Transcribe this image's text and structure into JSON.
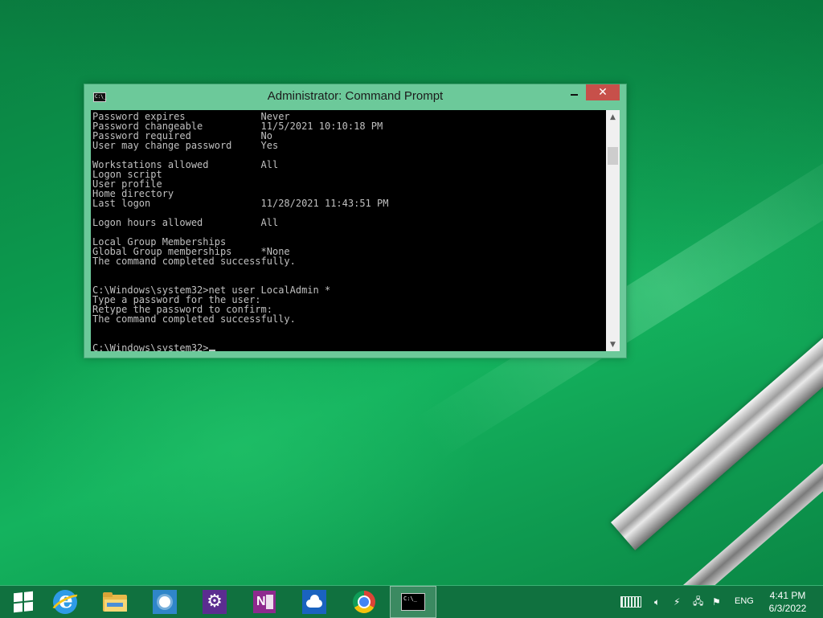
{
  "window": {
    "title": "Administrator: Command Prompt",
    "icon_label": "C:\\_"
  },
  "console": {
    "text": "Password expires             Never\nPassword changeable          11/5/2021 10:10:18 PM\nPassword required            No\nUser may change password     Yes\n\nWorkstations allowed         All\nLogon script\nUser profile\nHome directory\nLast logon                   11/28/2021 11:43:51 PM\n\nLogon hours allowed          All\n\nLocal Group Memberships\nGlobal Group memberships     *None\nThe command completed successfully.\n\n\nC:\\Windows\\system32>net user LocalAdmin *\nType a password for the user:\nRetype the password to confirm:\nThe command completed successfully.\n\n\n",
    "prompt": "C:\\Windows\\system32>"
  },
  "taskbar": {
    "apps": [
      {
        "name": "start",
        "icon": "windows-logo-icon"
      },
      {
        "name": "internet-explorer",
        "icon": "internet-explorer-icon"
      },
      {
        "name": "file-explorer",
        "icon": "folder-icon"
      },
      {
        "name": "weather",
        "icon": "sun-icon"
      },
      {
        "name": "settings",
        "icon": "gear-icon"
      },
      {
        "name": "onenote",
        "icon": "onenote-icon",
        "label": "N"
      },
      {
        "name": "onedrive",
        "icon": "cloud-icon"
      },
      {
        "name": "chrome",
        "icon": "chrome-icon"
      },
      {
        "name": "command-prompt",
        "icon": "command-prompt-icon",
        "label": "C:\\_",
        "active": true
      }
    ],
    "tray": {
      "language": "ENG",
      "time": "4:41 PM",
      "date": "6/3/2022"
    }
  }
}
